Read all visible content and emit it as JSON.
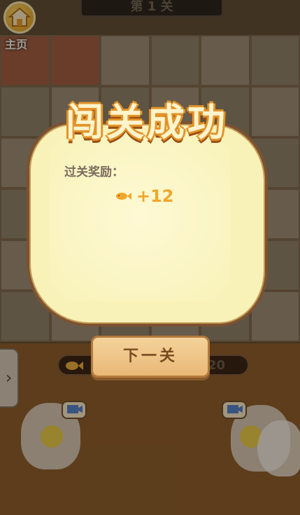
{
  "header": {
    "level_title": "第 1 关",
    "home_label": "主页"
  },
  "dialog": {
    "title": "闯关成功",
    "reward_label": "过关奖励：",
    "reward_amount": "+12",
    "next_button_label": "下一关"
  },
  "bottom": {
    "counter_value": "20"
  },
  "icons": {
    "home": "home-icon",
    "back": "chevron-left-icon",
    "fish": "fish-icon",
    "hint": "lightbulb-icon",
    "video": "video-icon"
  },
  "colors": {
    "accent": "#f0a62b",
    "panel": "#f8f2b8",
    "button": "#e9b878"
  }
}
